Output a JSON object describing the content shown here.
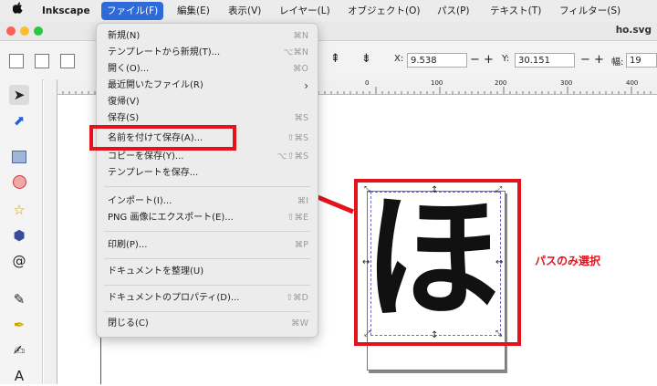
{
  "menubar": {
    "app": "Inkscape",
    "items": [
      "ファイル(F)",
      "編集(E)",
      "表示(V)",
      "レイヤー(L)",
      "オブジェクト(O)",
      "パス(P)",
      "テキスト(T)",
      "フィルター(S)"
    ]
  },
  "window": {
    "title": "ho.svg"
  },
  "toolbar": {
    "x_label": "X:",
    "x_value": "9.538",
    "y_label": "Y:",
    "y_value": "30.151",
    "w_label": "幅:",
    "w_value": "19",
    "minus": "−",
    "plus": "+"
  },
  "ruler": {
    "ticks": [
      "0",
      "100",
      "200",
      "300",
      "400"
    ]
  },
  "menu": {
    "items": [
      {
        "label": "新規(N)",
        "shortcut": "⌘N"
      },
      {
        "label": "テンプレートから新規(T)...",
        "shortcut": "⌥⌘N"
      },
      {
        "label": "開く(O)...",
        "shortcut": "⌘O"
      },
      {
        "label": "最近開いたファイル(R)",
        "shortcut": "›"
      },
      {
        "label": "復帰(V)",
        "shortcut": ""
      },
      {
        "label": "保存(S)",
        "shortcut": "⌘S"
      },
      {
        "label": "名前を付けて保存(A)...",
        "shortcut": "⇧⌘S"
      },
      {
        "label": "コピーを保存(Y)...",
        "shortcut": "⌥⇧⌘S"
      },
      {
        "label": "テンプレートを保存...",
        "shortcut": ""
      },
      {
        "label": "インポート(I)...",
        "shortcut": "⌘I"
      },
      {
        "label": "PNG 画像にエクスポート(E)...",
        "shortcut": "⇧⌘E"
      },
      {
        "label": "印刷(P)...",
        "shortcut": "⌘P"
      },
      {
        "label": "ドキュメントを整理(U)",
        "shortcut": ""
      },
      {
        "label": "ドキュメントのプロパティ(D)...",
        "shortcut": "⇧⌘D"
      },
      {
        "label": "閉じる(C)",
        "shortcut": "⌘W"
      }
    ]
  },
  "glyph": "ほ",
  "annotation": "パスのみ選択",
  "colors": {
    "highlight": "#e3121b",
    "menu_active": "#2f6ad6"
  }
}
